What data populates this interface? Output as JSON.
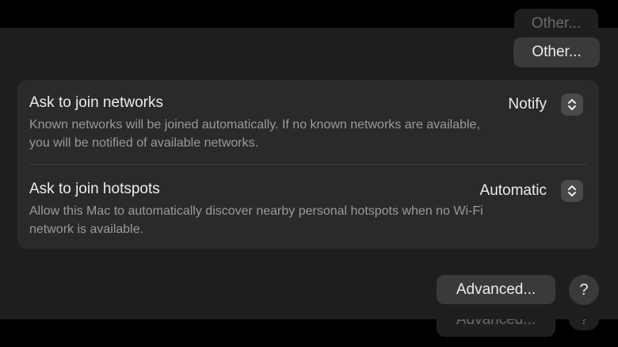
{
  "ghost": {
    "other_label": "Other...",
    "advanced_label": "Advanced...",
    "help_label": "?"
  },
  "buttons": {
    "other_label": "Other...",
    "advanced_label": "Advanced...",
    "help_label": "?"
  },
  "settings": [
    {
      "title": "Ask to join networks",
      "description": "Known networks will be joined automatically. If no known networks are available, you will be notified of available networks.",
      "value": "Notify"
    },
    {
      "title": "Ask to join hotspots",
      "description": "Allow this Mac to automatically discover nearby personal hotspots when no Wi-Fi network is available.",
      "value": "Automatic"
    }
  ],
  "icons": {
    "popup_stepper": "chevron-up-down-icon"
  },
  "colors": {
    "background": "#000000",
    "panel": "#1e1e1e",
    "group": "#2a2a2c",
    "button": "#3a3a3c",
    "text_primary": "#ececec",
    "text_secondary": "#9a9a9e"
  }
}
